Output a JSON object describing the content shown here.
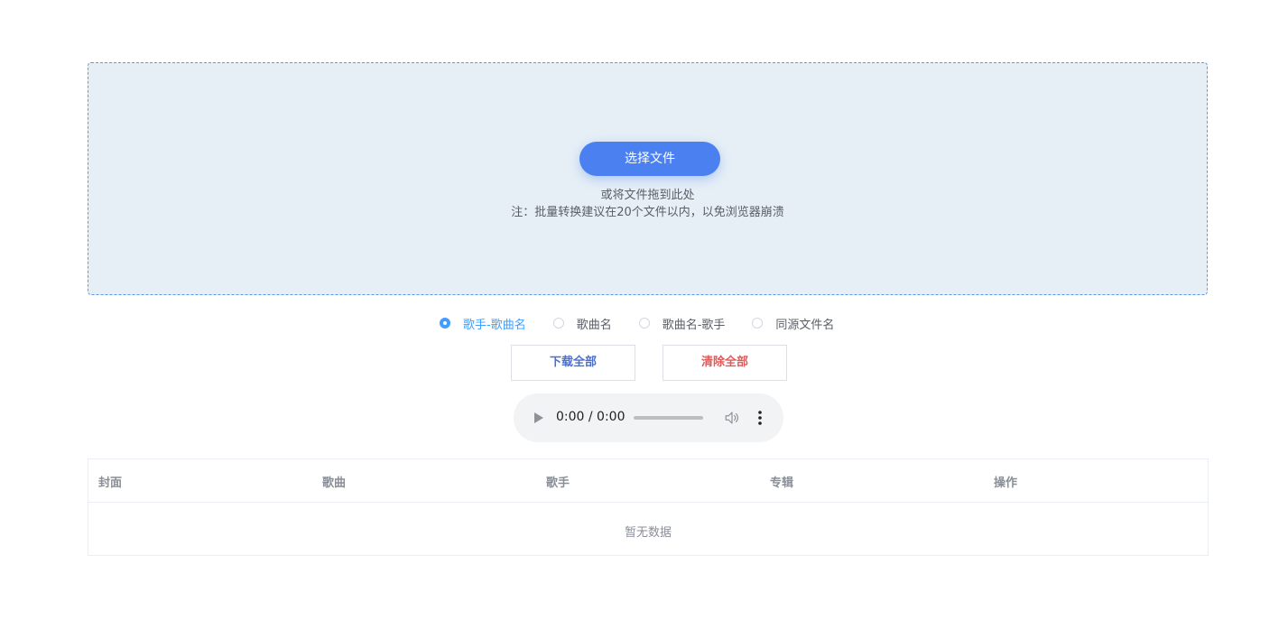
{
  "upload": {
    "choose_label": "选择文件",
    "drag_hint": "或将文件拖到此处",
    "note": "注：批量转换建议在20个文件以内，以免浏览器崩溃"
  },
  "naming_options": [
    {
      "label": "歌手-歌曲名",
      "checked": true
    },
    {
      "label": "歌曲名",
      "checked": false
    },
    {
      "label": "歌曲名-歌手",
      "checked": false
    },
    {
      "label": "同源文件名",
      "checked": false
    }
  ],
  "actions": {
    "download_all": "下载全部",
    "clear_all": "清除全部"
  },
  "player": {
    "time": "0:00 / 0:00",
    "icons": [
      "play-icon",
      "volume-icon",
      "more-vert-icon"
    ]
  },
  "table": {
    "columns": [
      "封面",
      "歌曲",
      "歌手",
      "专辑",
      "操作"
    ],
    "empty_text": "暂无数据"
  },
  "colors": {
    "accent": "#409eff",
    "primary_button": "#4a80f0",
    "danger": "#e05a5a",
    "upload_bg": "#e6eff6"
  }
}
